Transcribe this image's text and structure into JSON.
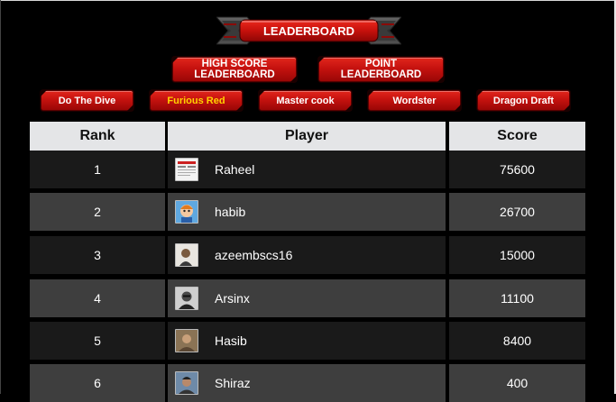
{
  "header": {
    "title": "LEADERBOARD"
  },
  "leaderboard_tabs": [
    {
      "label_line1": "HIGH SCORE",
      "label_line2": "LEADERBOARD"
    },
    {
      "label_line1": "POINT",
      "label_line2": "LEADERBOARD"
    }
  ],
  "games": [
    {
      "label": "Do The Dive",
      "active": false
    },
    {
      "label": "Furious Red",
      "active": true
    },
    {
      "label": "Master cook",
      "active": false
    },
    {
      "label": "Wordster",
      "active": false
    },
    {
      "label": "Dragon Draft",
      "active": false
    }
  ],
  "table": {
    "columns": [
      "Rank",
      "Player",
      "Score"
    ],
    "rows": [
      {
        "rank": "1",
        "player": "Raheel",
        "score": "75600",
        "avatar": "newspaper-avatar"
      },
      {
        "rank": "2",
        "player": "habib",
        "score": "26700",
        "avatar": "cartoon-avatar"
      },
      {
        "rank": "3",
        "player": "azeembscs16",
        "score": "15000",
        "avatar": "photo-avatar"
      },
      {
        "rank": "4",
        "player": "Arsinx",
        "score": "11100",
        "avatar": "bw-photo-avatar"
      },
      {
        "rank": "5",
        "player": "Hasib",
        "score": "8400",
        "avatar": "photo-avatar"
      },
      {
        "rank": "6",
        "player": "Shiraz",
        "score": "400",
        "avatar": "photo-avatar"
      }
    ]
  },
  "colors": {
    "accent": "#c5120f",
    "active_text": "#ffd200",
    "header_bg": "#e4e5e7"
  }
}
